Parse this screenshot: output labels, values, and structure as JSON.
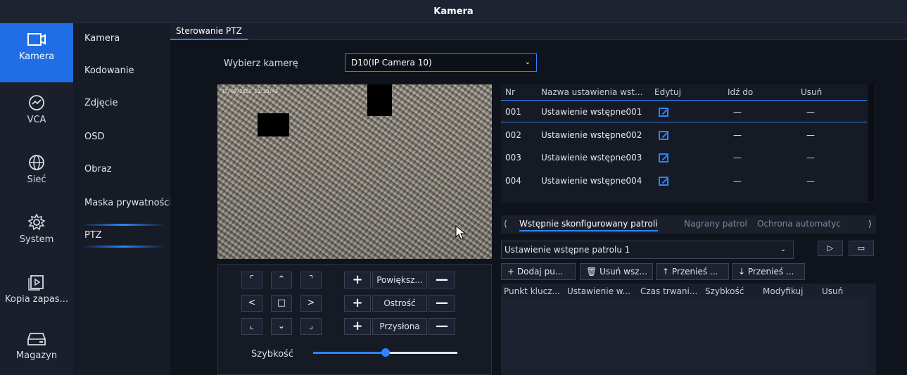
{
  "window": {
    "title": "Kamera"
  },
  "nav": [
    {
      "label": "Kamera",
      "icon": "camera-icon",
      "active": true
    },
    {
      "label": "VCA",
      "icon": "vca-icon"
    },
    {
      "label": "Sieć",
      "icon": "globe-icon"
    },
    {
      "label": "System",
      "icon": "gear-icon"
    },
    {
      "label": "Kopia zapas...",
      "icon": "backup-icon"
    },
    {
      "label": "Magazyn",
      "icon": "storage-icon"
    }
  ],
  "subnav": [
    "Kamera",
    "Kodowanie",
    "Zdjęcie",
    "OSD",
    "Obraz",
    "Maska prywatności",
    "PTZ"
  ],
  "tab": "Sterowanie PTZ",
  "camera_select": {
    "label": "Wybierz kamerę",
    "value": "D10(IP Camera 10)"
  },
  "video": {
    "timestamp": "17/08/2022 13:29:43"
  },
  "ptz": {
    "zoom_label": "Powiększ...",
    "focus_label": "Ostrość",
    "iris_label": "Przysłona",
    "speed_label": "Szybkość",
    "speed_fraction": 0.5,
    "accent": "#2b86ff"
  },
  "presets": {
    "headers": {
      "nr": "Nr",
      "name": "Nazwa ustawienia wst...",
      "edit": "Edytuj",
      "goto": "Idź do",
      "delete": "Usuń"
    },
    "rows": [
      {
        "nr": "001",
        "name": "Ustawienie wstępne001",
        "goto": "—",
        "delete": "—"
      },
      {
        "nr": "002",
        "name": "Ustawienie wstępne002",
        "goto": "—",
        "delete": "—"
      },
      {
        "nr": "003",
        "name": "Ustawienie wstępne003",
        "goto": "—",
        "delete": "—"
      },
      {
        "nr": "004",
        "name": "Ustawienie wstępne004",
        "goto": "—",
        "delete": "—"
      }
    ]
  },
  "patrol": {
    "tabs": [
      "Wstępnie skonfigurowany patroli",
      "Nagrany patrol",
      "Ochrona automatyc"
    ],
    "select_value": "Ustawienie wstępne patrolu 1",
    "buttons": {
      "add": "Dodaj pu...",
      "delete_all": "Usuń wsz...",
      "move_up": "Przenieś ...",
      "move_down": "Przenieś ..."
    },
    "columns": [
      "Punkt klucz...",
      "Ustawienie w...",
      "Czas trwani...",
      "Szybkość",
      "Modyfikuj",
      "Usuń"
    ]
  }
}
